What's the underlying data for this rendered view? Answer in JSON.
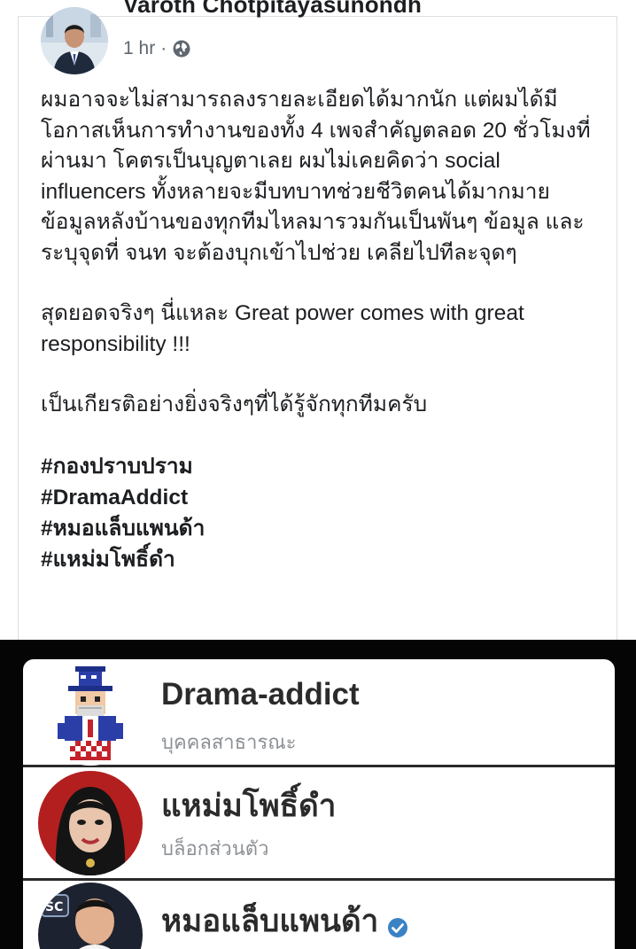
{
  "post": {
    "author_name": "Varoth Chotpitayasunondh",
    "timestamp": "1 hr",
    "separator": "·",
    "privacy_icon": "globe-icon",
    "paragraphs": [
      "ผมอาจจะไม่สามารถลงรายละเอียดได้มากนัก แต่ผมได้มีโอกาสเห็นการทำงานของทั้ง 4 เพจสำคัญตลอด 20 ชั่วโมงที่ผ่านมา โคตรเป็นบุญตาเลย ผมไม่เคยคิดว่า social influencers ทั้งหลายจะมีบทบาทช่วยชีวิตคนได้มากมาย ข้อมูลหลังบ้านของทุกทีมไหลมารวมกันเป็นพันๆ ข้อมูล และระบุจุดที่ จนท จะต้องบุกเข้าไปช่วย เคลียไปทีละจุดๆ",
      "สุดยอดจริงๆ นี่แหละ Great power comes with great responsibility !!!",
      "เป็นเกียรติอย่างยิ่งจริงๆที่ได้รู้จักทุกทีมครับ"
    ],
    "hashtags": [
      "#กองปราบปราม",
      "#DramaAddict",
      "#หมอแล็บแพนด้า",
      "#แหม่มโพธิ์ดำ"
    ]
  },
  "embed": {
    "pages": [
      {
        "name": "Drama-addict",
        "category": "บุคคลสาธารณะ",
        "verified": false
      },
      {
        "name": "แหม่มโพธิ์ดำ",
        "category": "บล็อกส่วนตัว",
        "verified": false
      },
      {
        "name": "หมอแล็บแพนด้า",
        "category": "",
        "verified": true
      }
    ],
    "badge_text": "SC"
  },
  "colors": {
    "text": "#1c1e21",
    "meta": "#606770",
    "verified": "#3b82c4",
    "embed_bg": "#050505"
  }
}
